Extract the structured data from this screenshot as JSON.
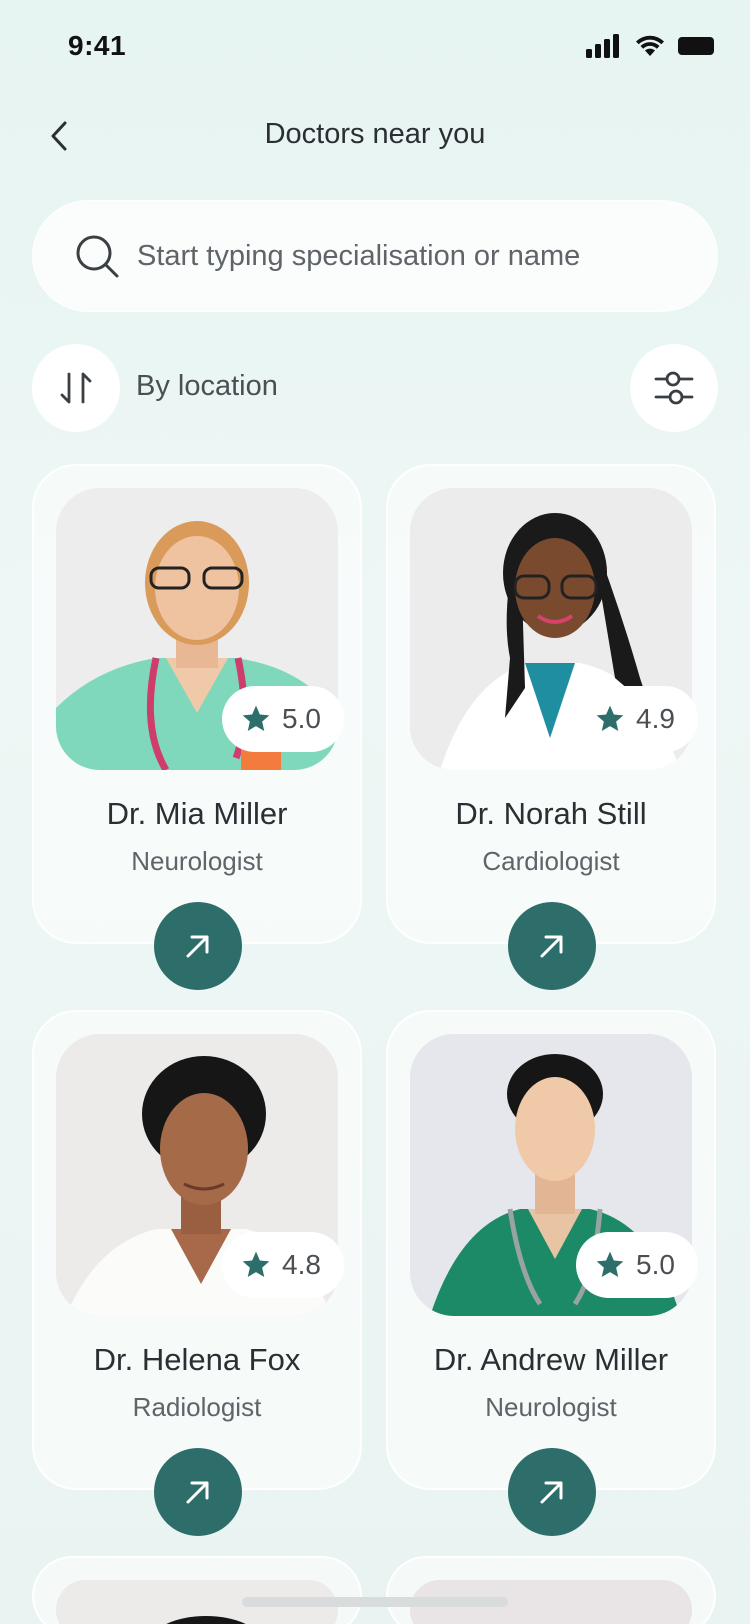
{
  "status_bar": {
    "time": "9:41"
  },
  "header": {
    "title": "Doctors near you"
  },
  "search": {
    "placeholder": "Start typing specialisation or name"
  },
  "sort": {
    "label": "By location"
  },
  "colors": {
    "accent": "#2d6e6b",
    "star": "#2d6e6b"
  },
  "doctors": [
    {
      "name": "Dr. Mia Miller",
      "specialty": "Neurologist",
      "rating": "5.0"
    },
    {
      "name": "Dr. Norah Still",
      "specialty": "Cardiologist",
      "rating": "4.9"
    },
    {
      "name": "Dr. Helena Fox",
      "specialty": "Radiologist",
      "rating": "4.8"
    },
    {
      "name": "Dr. Andrew Miller",
      "specialty": "Neurologist",
      "rating": "5.0"
    }
  ]
}
